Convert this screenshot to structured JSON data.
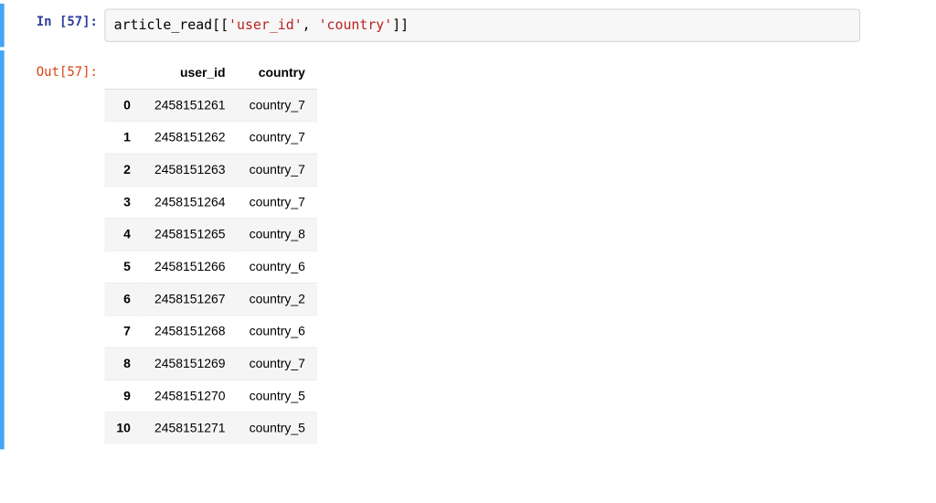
{
  "prompts": {
    "in_label": "In [57]:",
    "out_label": "Out[57]:"
  },
  "code": {
    "var": "article_read",
    "col1_literal": "'user_id'",
    "col2_literal": "'country'"
  },
  "table": {
    "columns": [
      "user_id",
      "country"
    ],
    "index": [
      "0",
      "1",
      "2",
      "3",
      "4",
      "5",
      "6",
      "7",
      "8",
      "9",
      "10"
    ],
    "rows": [
      {
        "user_id": "2458151261",
        "country": "country_7"
      },
      {
        "user_id": "2458151262",
        "country": "country_7"
      },
      {
        "user_id": "2458151263",
        "country": "country_7"
      },
      {
        "user_id": "2458151264",
        "country": "country_7"
      },
      {
        "user_id": "2458151265",
        "country": "country_8"
      },
      {
        "user_id": "2458151266",
        "country": "country_6"
      },
      {
        "user_id": "2458151267",
        "country": "country_2"
      },
      {
        "user_id": "2458151268",
        "country": "country_6"
      },
      {
        "user_id": "2458151269",
        "country": "country_7"
      },
      {
        "user_id": "2458151270",
        "country": "country_5"
      },
      {
        "user_id": "2458151271",
        "country": "country_5"
      }
    ]
  },
  "chart_data": {
    "type": "table",
    "title": "",
    "columns": [
      "index",
      "user_id",
      "country"
    ],
    "rows": [
      [
        0,
        2458151261,
        "country_7"
      ],
      [
        1,
        2458151262,
        "country_7"
      ],
      [
        2,
        2458151263,
        "country_7"
      ],
      [
        3,
        2458151264,
        "country_7"
      ],
      [
        4,
        2458151265,
        "country_8"
      ],
      [
        5,
        2458151266,
        "country_6"
      ],
      [
        6,
        2458151267,
        "country_2"
      ],
      [
        7,
        2458151268,
        "country_6"
      ],
      [
        8,
        2458151269,
        "country_7"
      ],
      [
        9,
        2458151270,
        "country_5"
      ],
      [
        10,
        2458151271,
        "country_5"
      ]
    ]
  }
}
